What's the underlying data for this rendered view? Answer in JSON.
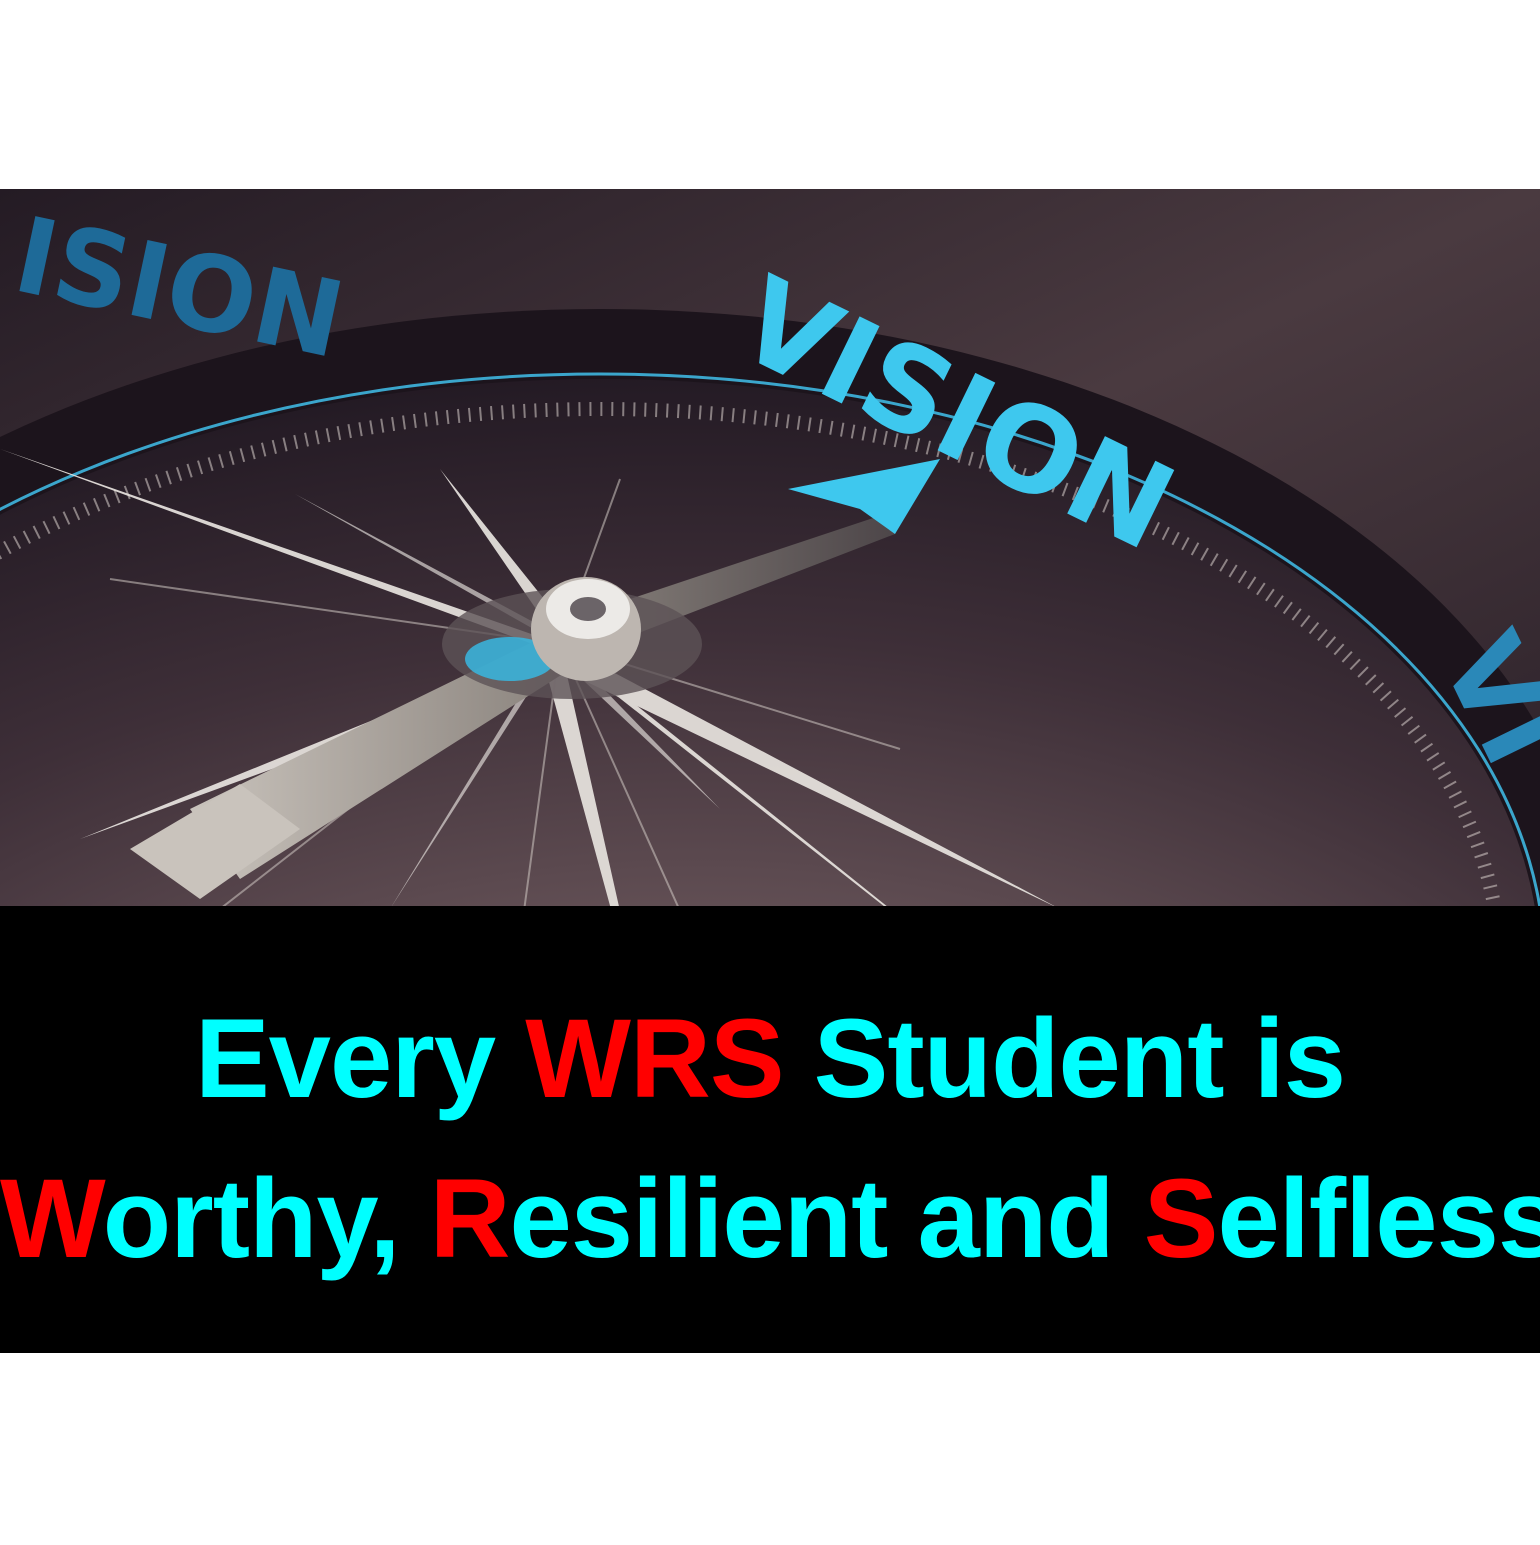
{
  "photo": {
    "dial_word_top": "ISION",
    "dial_word_main": "VISION",
    "dial_word_right": "VI"
  },
  "colors": {
    "accent_text": "#00ffff",
    "highlight_text": "#ff0000",
    "banner_bg": "#000000",
    "dial_blue": "#3ec8ee"
  },
  "caption": {
    "line1": {
      "part1": "Every ",
      "part2": "WRS",
      "part3": " Student is"
    },
    "line2": {
      "w": "W",
      "w_rest": "orthy, ",
      "r": "R",
      "r_rest": "esilient and ",
      "s": "S",
      "s_rest": "elfless"
    }
  }
}
